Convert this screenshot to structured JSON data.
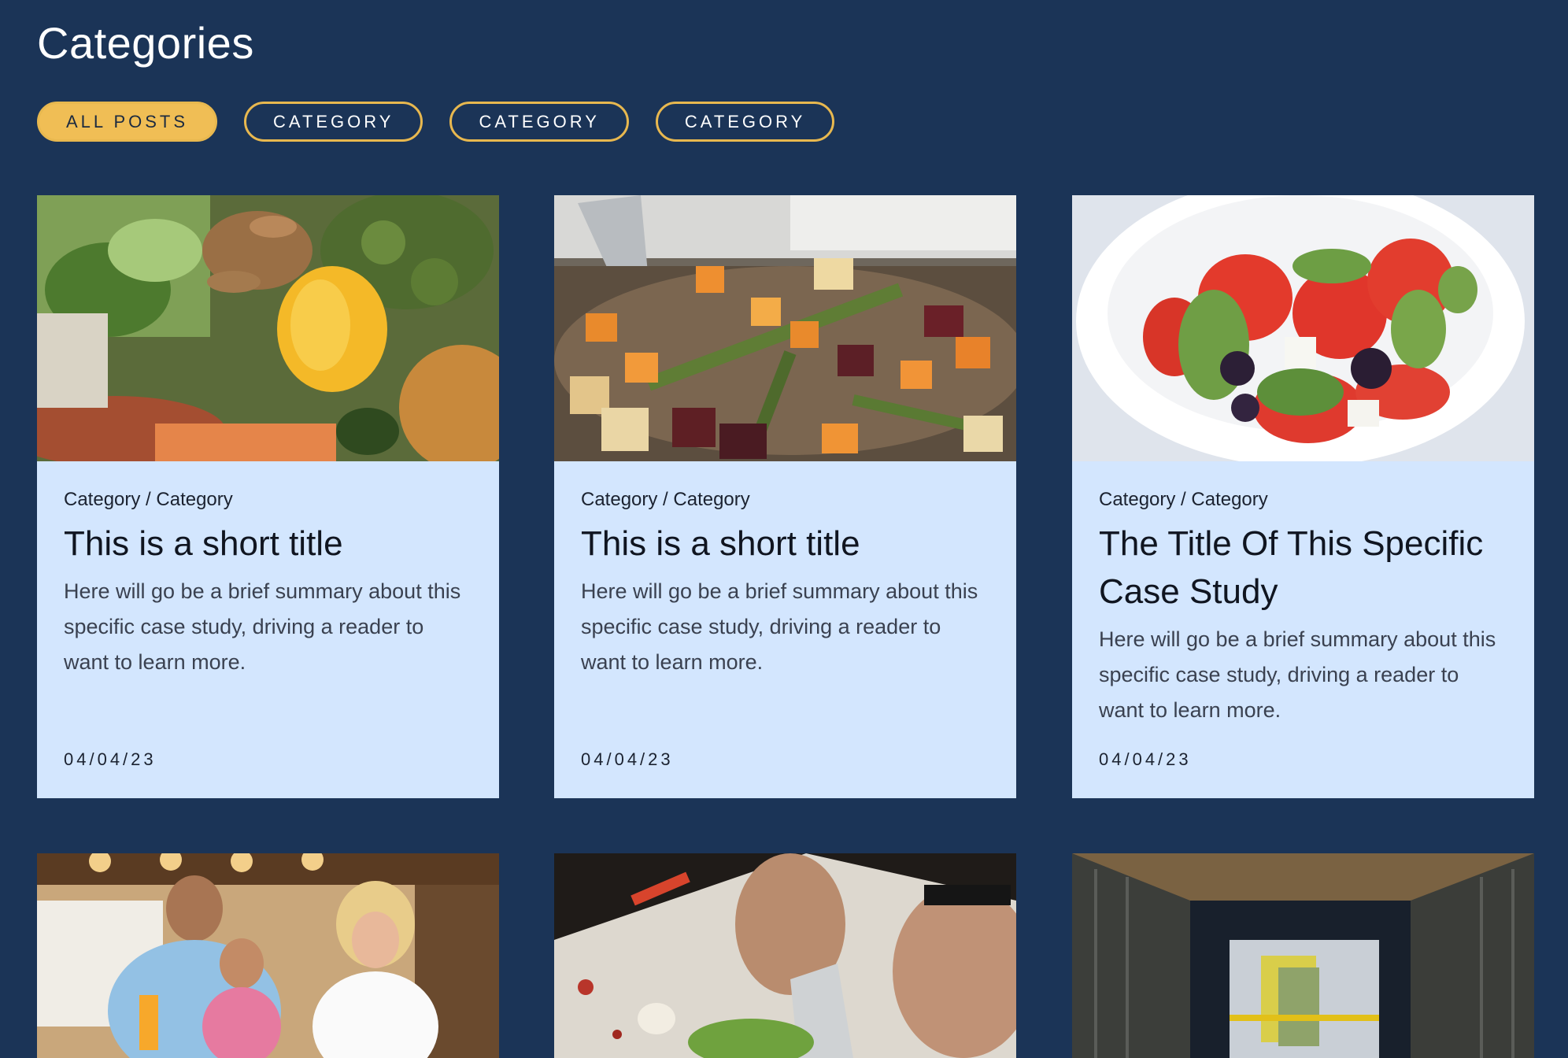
{
  "page": {
    "title": "Categories"
  },
  "filters": [
    {
      "label": "ALL POSTS",
      "active": true
    },
    {
      "label": "CATEGORY",
      "active": false
    },
    {
      "label": "CATEGORY",
      "active": false
    },
    {
      "label": "CATEGORY",
      "active": false
    }
  ],
  "cards": [
    {
      "meta": "Category / Category",
      "title": "This is a short title",
      "summary": "Here will go be a brief summary about this specific case study, driving a reader to want to learn more.",
      "date": "04/04/23",
      "image": "vegetables-photo"
    },
    {
      "meta": "Category / Category",
      "title": "This is a short title",
      "summary": "Here will go be a brief summary about this specific case study, driving a reader to want to learn more.",
      "date": "04/04/23",
      "image": "roasted-vegetables-photo"
    },
    {
      "meta": "Category / Category",
      "title": "The Title Of This Specific Case Study",
      "summary": "Here will go be a brief summary about this specific case study, driving a reader to want to learn more.",
      "date": "04/04/23",
      "image": "caprese-salad-photo"
    }
  ],
  "second_row_images": [
    "family-dining-photo",
    "chopping-vegetables-photo",
    "warehouse-truck-photo"
  ],
  "colors": {
    "background": "#1b3457",
    "accent": "#f0be55",
    "card": "#d3e6fe"
  }
}
